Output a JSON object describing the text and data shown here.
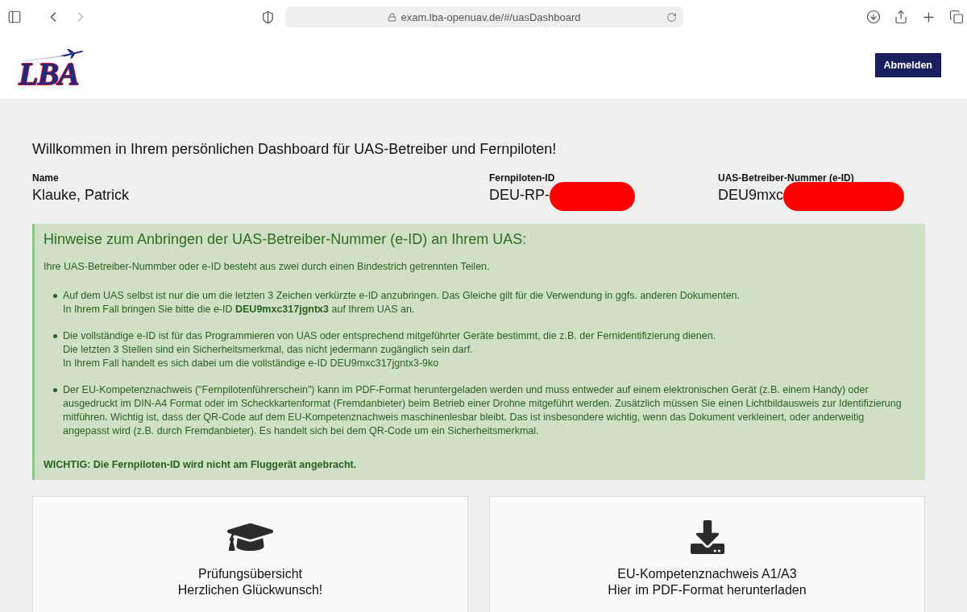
{
  "browser": {
    "url": "exam.lba-openuav.de/#/uasDashboard",
    "back_disabled": false,
    "forward_disabled": true
  },
  "header": {
    "logo_text": "LBA",
    "logout_button": "Abmelden"
  },
  "welcome_title": "Willkommen in Ihrem persönlichen Dashboard für UAS-Betreiber und Fernpiloten!",
  "profile_fields": [
    {
      "label": "Name",
      "value": "Klauke, Patrick",
      "redacted": false
    },
    {
      "label": "Fernpiloten-ID",
      "value": "DEU-RP-",
      "redacted": true
    },
    {
      "label": "UAS-Betreiber-Nummer (e-ID)",
      "value": "DEU9mxc",
      "redacted": true
    }
  ],
  "hint_box": {
    "title": "Hinweise zum Anbringen der UAS-Betreiber-Nummer (e-ID) an Ihrem UAS:",
    "intro": "Ihre UAS-Betreiber-Nummber oder e-ID besteht aus zwei durch einen Bindestrich getrennten Teilen.",
    "items": [
      {
        "lines": [
          "Auf dem UAS selbst ist nur die um die letzten 3 Zeichen verkürzte e-ID anzubringen. Das Gleiche gilt für die Verwendung in ggfs. anderen Dokumenten.",
          "In Ihrem Fall bringen Sie bitte die e-ID **DEU9mxc317jgntx3** auf Ihrem UAS an."
        ]
      },
      {
        "lines": [
          "Die vollständige e-ID ist für das Programmieren von UAS oder entsprechend mitgeführter Geräte bestimmt, die z.B. der Fernidentifizierung dienen.",
          "Die letzten 3 Stellen sind ein Sicherheitsmerkmal, das nicht jedermann zugänglich sein darf.",
          "In Ihrem Fall handelt es sich dabei um die vollständige e-ID DEU9mxc317jgntx3-9ko"
        ]
      },
      {
        "lines": [
          "Der EU-Kompetenznachweis (\"Fernpilotenführerschein\") kann im PDF-Format heruntergeladen werden und muss entweder auf einem elektronischen Gerät (z.B. einem Handy) oder ausgedruckt im DIN-A4 Format oder im Scheckkartenformat (Fremdanbieter) beim Betrieb einer Drohne mitgeführt werden. Zusätzlich müssen Sie einen Lichtbildausweis zur Identifizierung mitführen. Wichtig ist, dass der QR-Code auf dem EU-Kompetenznachweis maschinenlesbar bleibt. Das ist insbesondere wichtig, wenn das Dokument verkleinert, oder anderweitig angepasst wird (z.B. durch Fremdanbieter). Es handelt sich bei dem QR-Code um ein Sicherheitsmerkmal."
        ]
      }
    ],
    "warning": "WICHTIG: Die Fernpiloten-ID wird nicht am Fluggerät angebracht."
  },
  "cards": [
    {
      "kind": "exam",
      "title": "Prüfungsübersicht",
      "subtitle": "Herzlichen Glückwunsch!"
    },
    {
      "kind": "download",
      "title": "EU-Kompetenznachweis A1/A3",
      "subtitle": "Hier im PDF-Format herunterladen"
    }
  ]
}
